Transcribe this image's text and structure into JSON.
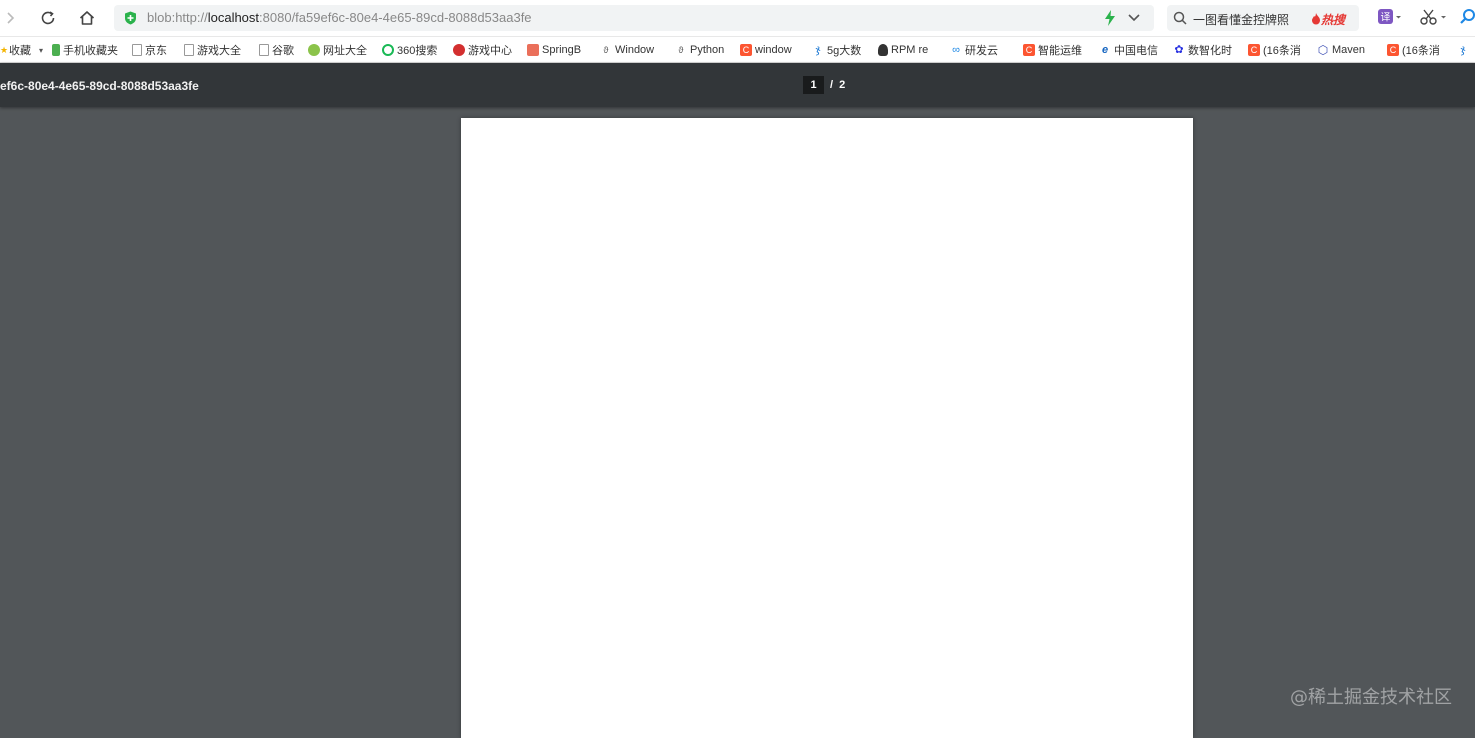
{
  "browser": {
    "url_prefix": "blob:http://",
    "url_host": "localhost",
    "url_rest": ":8080/fa59ef6c-80e4-4e65-89cd-8088d53aa3fe",
    "search_text": "一图看懂金控牌照",
    "search_badge": "热搜"
  },
  "bookmarks": [
    {
      "label": "收藏",
      "icon": "star-icon",
      "color": "#f4b400"
    },
    {
      "label": "手机收藏夹",
      "icon": "phone-icon",
      "color": "#4caf50"
    },
    {
      "label": "京东",
      "icon": "page-icon",
      "color": "#999999"
    },
    {
      "label": "游戏大全",
      "icon": "page-icon",
      "color": "#999999"
    },
    {
      "label": "谷歌",
      "icon": "page-icon",
      "color": "#999999"
    },
    {
      "label": "网址大全",
      "icon": "globe-icon",
      "color": "#8bc34a"
    },
    {
      "label": "360搜索",
      "icon": "360-icon",
      "color": "#19b955"
    },
    {
      "label": "游戏中心",
      "icon": "game-icon",
      "color": "#d32f2f"
    },
    {
      "label": "SpringB",
      "icon": "jian-icon",
      "color": "#ea6f5a"
    },
    {
      "label": "Window",
      "icon": "book-icon",
      "color": "#555555"
    },
    {
      "label": "Python",
      "icon": "book-icon",
      "color": "#555555"
    },
    {
      "label": "window",
      "icon": "csdn-icon",
      "color": "#fc5531"
    },
    {
      "label": "5g大数",
      "icon": "telecom-icon",
      "color": "#1976d2"
    },
    {
      "label": "RPM re",
      "icon": "linux-icon",
      "color": "#333333"
    },
    {
      "label": "研发云",
      "icon": "cloud-icon",
      "color": "#1e88e5"
    },
    {
      "label": "智能运维",
      "icon": "csdn-icon",
      "color": "#fc5531"
    },
    {
      "label": "中国电信",
      "icon": "ie-icon",
      "color": "#1565c0"
    },
    {
      "label": "数智化时",
      "icon": "baidu-icon",
      "color": "#2932e1"
    },
    {
      "label": "(16条消",
      "icon": "csdn-icon",
      "color": "#fc5531"
    },
    {
      "label": "Maven",
      "icon": "hexagon-icon",
      "color": "#3f51b5"
    },
    {
      "label": "(16条消",
      "icon": "csdn-icon",
      "color": "#fc5531"
    }
  ],
  "pdf": {
    "title": "ef6c-80e4-4e65-89cd-8088d53aa3fe",
    "current_page": "1",
    "separator": "/",
    "total_pages": "2"
  },
  "watermark": "@稀土掘金技术社区"
}
